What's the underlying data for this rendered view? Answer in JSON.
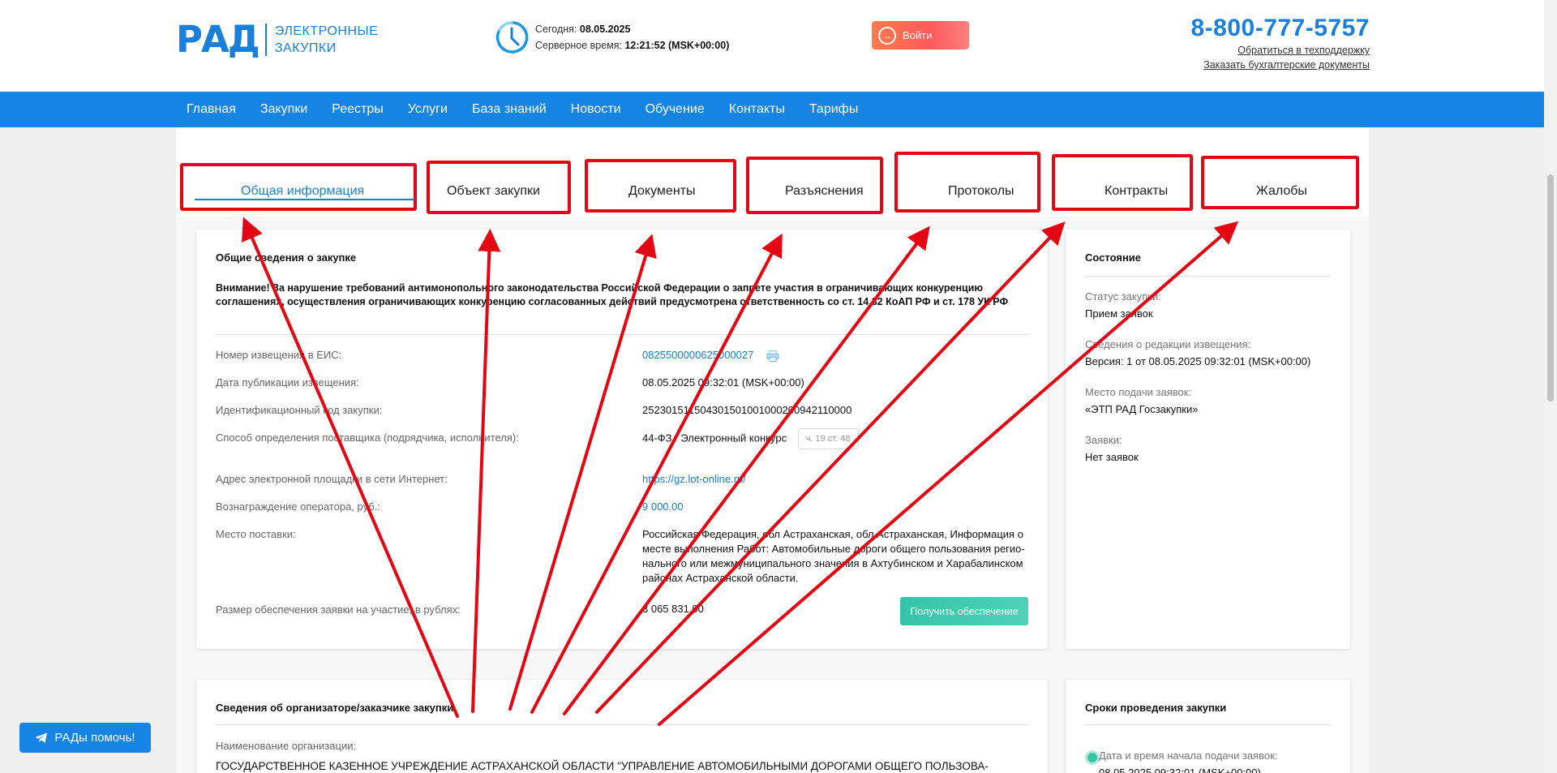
{
  "header": {
    "logo_mark": "РАД",
    "logo_line1": "ЭЛЕКТРОННЫЕ",
    "logo_line2": "ЗАКУПКИ",
    "today_label": "Сегодня:",
    "today_value": "08.05.2025",
    "server_time_label": "Серверное время:",
    "server_time_value": "12:21:52 (MSK+00:00)",
    "login_label": "Войти",
    "phone": "8-800-777-5757",
    "support_link": "Обратиться в техподдержку",
    "accounting_link": "Заказать бухгалтерские документы"
  },
  "nav": {
    "items": [
      "Главная",
      "Закупки",
      "Реестры",
      "Услуги",
      "База знаний",
      "Новости",
      "Обучение",
      "Контакты",
      "Тарифы"
    ]
  },
  "tabs": [
    "Общая информация",
    "Объект закупки",
    "Документы",
    "Разъяснения",
    "Протоколы",
    "Контракты",
    "Жалобы"
  ],
  "general": {
    "title": "Общие сведения о закупке",
    "warning": "Внимание! За нарушение требований антимонопольного законодательства Российской Федерации о запрете участия в ограничивающих конкуренцию соглашениях, осуществления ограничивающих конкуренцию согласованных действий предусмотрена ответственность со ст. 14.32 КоАП РФ и ст. 178 УК РФ",
    "rows": [
      {
        "label": "Номер извещения в ЕИС:",
        "value": "0825500000625000027"
      },
      {
        "label": "Дата публикации извещения:",
        "value": "08.05.2025 09:32:01 (MSK+00:00)"
      },
      {
        "label": "Идентификационный код закупки:",
        "value": "252301511504301501001000200942110000"
      },
      {
        "label": "Способ определения поставщика (подрядчика, исполнителя):",
        "value": "44-ФЗ / Электронный конкурс",
        "tag": "ч. 19 ст. 48"
      },
      {
        "label": "Адрес электронной площадки в сети Интернет:",
        "value": "https://gz.lot-online.ru/"
      },
      {
        "label": "Вознаграждение оператора, руб.:",
        "value": "9 000.00"
      },
      {
        "label": "Место поставки:",
        "value": "Российская Федерация, обл Астраханская, обл Астраханская, Информация о месте выполнения Работ: Автомобильные дороги общего пользования регио­нального или межмуниципального значения в Ахтубинском и Харабалинском районах Астраханской области."
      },
      {
        "label": "Размер обеспечения заявки на участие, в рублях:",
        "value": "3 065 831.00"
      }
    ],
    "get_security_button": "Получить обеспечение"
  },
  "status": {
    "title": "Состояние",
    "items": [
      {
        "label": "Статус закупки:",
        "value": "Прием заявок"
      },
      {
        "label": "Сведения о редакции извещения:",
        "value": "Версия: 1 от 08.05.2025 09:32:01 (MSK+00:00)"
      },
      {
        "label": "Место подачи заявок:",
        "value": "«ЭТП РАД Госзакупки»"
      },
      {
        "label": "Заявки:",
        "value": "Нет заявок"
      }
    ]
  },
  "organizer": {
    "title": "Сведения об организаторе/заказчике закупки",
    "org_label": "Наименование организации:",
    "org_value": "ГОСУДАРСТВЕННОЕ КАЗЕННОЕ УЧРЕЖДЕНИЕ АСТРАХАНСКОЙ ОБЛАСТИ \"УПРАВЛЕНИЕ АВТОМОБИЛЬНЫМИ ДОРОГАМИ ОБЩЕГО ПОЛЬЗОВА-"
  },
  "deadlines": {
    "title": "Сроки проведения закупки",
    "start_label": "Дата и время начала подачи заявок:",
    "start_value": "08.05.2025 09:32:01 (MSK+00:00)"
  },
  "help_button": "РАДы помочь!",
  "colors": {
    "accent": "#1684e3",
    "annotation": "#e30613",
    "green": "#35c4a7"
  }
}
